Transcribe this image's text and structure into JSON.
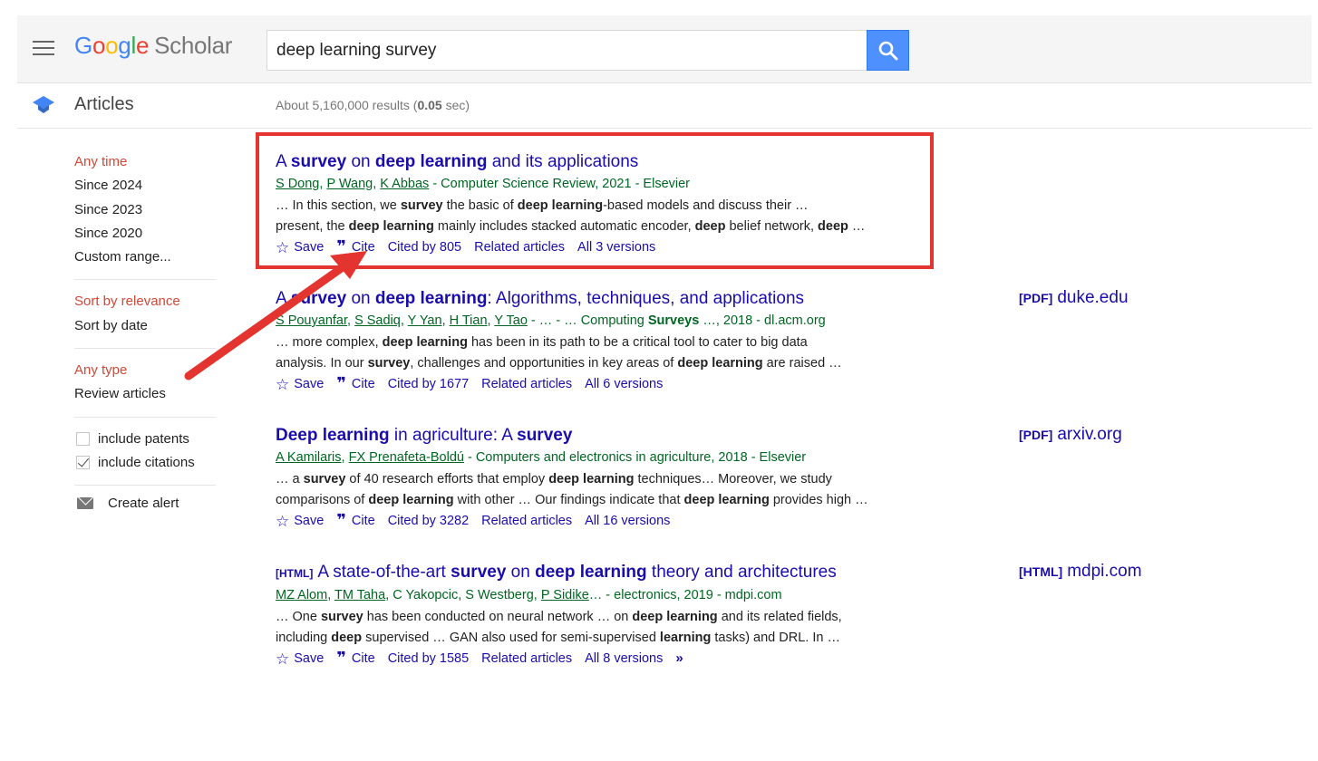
{
  "header": {
    "logo_google": "Google",
    "logo_scholar": "Scholar",
    "search_value": "deep learning survey"
  },
  "subheader": {
    "section_label": "Articles",
    "results_prefix": "About 5,160,000 results (",
    "results_time": "0.05",
    "results_suffix": " sec)"
  },
  "sidebar": {
    "time_filters": [
      "Any time",
      "Since 2024",
      "Since 2023",
      "Since 2020",
      "Custom range..."
    ],
    "sort_options": [
      "Sort by relevance",
      "Sort by date"
    ],
    "type_options": [
      "Any type",
      "Review articles"
    ],
    "include_patents": "include patents",
    "include_citations": "include citations",
    "create_alert": "Create alert"
  },
  "results": [
    {
      "title": [
        {
          "t": "A ",
          "b": false
        },
        {
          "t": "survey",
          "b": true
        },
        {
          "t": " on ",
          "b": false
        },
        {
          "t": "deep learning",
          "b": true
        },
        {
          "t": " and its applications",
          "b": false
        }
      ],
      "authors": [
        "S Dong",
        "P Wang",
        "K Abbas"
      ],
      "meta_rest": " - Computer Science Review, 2021 - Elsevier",
      "snippet": [
        [
          {
            "t": "… In this section, we ",
            "b": false
          },
          {
            "t": "survey",
            "b": true
          },
          {
            "t": " the basic of ",
            "b": false
          },
          {
            "t": "deep learning",
            "b": true
          },
          {
            "t": "-based models and discuss their …",
            "b": false
          }
        ],
        [
          {
            "t": "present, the ",
            "b": false
          },
          {
            "t": "deep learning",
            "b": true
          },
          {
            "t": " mainly includes stacked automatic encoder, ",
            "b": false
          },
          {
            "t": "deep",
            "b": true
          },
          {
            "t": " belief network, ",
            "b": false
          },
          {
            "t": "deep",
            "b": true
          },
          {
            "t": " …",
            "b": false
          }
        ]
      ],
      "save": "Save",
      "cite": "Cite",
      "cited_by": "Cited by 805",
      "related": "Related articles",
      "versions": "All 3 versions"
    },
    {
      "title": [
        {
          "t": "A ",
          "b": false
        },
        {
          "t": "survey",
          "b": true
        },
        {
          "t": " on ",
          "b": false
        },
        {
          "t": "deep learning",
          "b": true
        },
        {
          "t": ": Algorithms, techniques, and applications",
          "b": false
        }
      ],
      "authors": [
        "S Pouyanfar",
        "S Sadiq",
        "Y Yan",
        "H Tian",
        "Y Tao"
      ],
      "meta_rest_parts": [
        {
          "t": "… - … Computing ",
          "b": false
        },
        {
          "t": "Surveys",
          "b": true
        },
        {
          "t": "  …, 2018 - dl.acm.org",
          "b": false
        }
      ],
      "snippet": [
        [
          {
            "t": "… more complex, ",
            "b": false
          },
          {
            "t": "deep learning",
            "b": true
          },
          {
            "t": " has been in its path to be a critical tool to cater to big data",
            "b": false
          }
        ],
        [
          {
            "t": "analysis. In our ",
            "b": false
          },
          {
            "t": "survey",
            "b": true
          },
          {
            "t": ", challenges and opportunities in key areas of ",
            "b": false
          },
          {
            "t": "deep learning",
            "b": true
          },
          {
            "t": " are raised …",
            "b": false
          }
        ]
      ],
      "save": "Save",
      "cite": "Cite",
      "cited_by": "Cited by 1677",
      "related": "Related articles",
      "versions": "All 6 versions",
      "side_type": "[PDF]",
      "side_domain": "duke.edu"
    },
    {
      "title": [
        {
          "t": "Deep learning",
          "b": true
        },
        {
          "t": " in agriculture: A ",
          "b": false
        },
        {
          "t": "survey",
          "b": true
        }
      ],
      "authors": [
        "A Kamilaris",
        "FX Prenafeta-Boldú"
      ],
      "meta_rest": " - Computers and electronics in agriculture, 2018 - Elsevier",
      "snippet": [
        [
          {
            "t": "… a ",
            "b": false
          },
          {
            "t": "survey",
            "b": true
          },
          {
            "t": " of 40 research efforts that employ ",
            "b": false
          },
          {
            "t": "deep learning",
            "b": true
          },
          {
            "t": " techniques… Moreover, we study",
            "b": false
          }
        ],
        [
          {
            "t": "comparisons of ",
            "b": false
          },
          {
            "t": "deep learning",
            "b": true
          },
          {
            "t": " with other … Our findings indicate that ",
            "b": false
          },
          {
            "t": "deep learning",
            "b": true
          },
          {
            "t": " provides high …",
            "b": false
          }
        ]
      ],
      "save": "Save",
      "cite": "Cite",
      "cited_by": "Cited by 3282",
      "related": "Related articles",
      "versions": "All 16 versions",
      "side_type": "[PDF]",
      "side_domain": "arxiv.org"
    },
    {
      "tag": "[HTML]",
      "title": [
        {
          "t": "A state-of-the-art ",
          "b": false
        },
        {
          "t": "survey",
          "b": true
        },
        {
          "t": " on ",
          "b": false
        },
        {
          "t": "deep learning",
          "b": true
        },
        {
          "t": " theory and architectures",
          "b": false
        }
      ],
      "authors_mixed": [
        {
          "t": "MZ Alom",
          "u": true
        },
        {
          "t": "TM Taha",
          "u": true
        },
        {
          "t": "C Yakopcic",
          "u": false
        },
        {
          "t": "S Westberg",
          "u": false
        },
        {
          "t": "P Sidike",
          "u": true
        }
      ],
      "meta_rest": "… - electronics, 2019 - mdpi.com",
      "snippet": [
        [
          {
            "t": "… One ",
            "b": false
          },
          {
            "t": "survey",
            "b": true
          },
          {
            "t": " has been conducted on neural network … on ",
            "b": false
          },
          {
            "t": "deep learning",
            "b": true
          },
          {
            "t": " and its related fields,",
            "b": false
          }
        ],
        [
          {
            "t": "including ",
            "b": false
          },
          {
            "t": "deep",
            "b": true
          },
          {
            "t": " supervised … GAN also used for semi-supervised ",
            "b": false
          },
          {
            "t": "learning",
            "b": true
          },
          {
            "t": " tasks) and DRL. In …",
            "b": false
          }
        ]
      ],
      "save": "Save",
      "cite": "Cite",
      "cited_by": "Cited by 1585",
      "related": "Related articles",
      "versions": "All 8 versions",
      "side_type": "[HTML]",
      "side_domain": "mdpi.com"
    }
  ],
  "icons": {
    "menu": "menu-icon",
    "search": "search-icon",
    "articles": "scholar-cap-icon",
    "star": "☆",
    "quote": "❞",
    "more": "»"
  },
  "colors": {
    "link": "#1a0dab",
    "meta_green": "#006621",
    "sidebar_red": "#d14836",
    "search_button": "#4d90fe",
    "annotation_red": "#e3342f"
  }
}
